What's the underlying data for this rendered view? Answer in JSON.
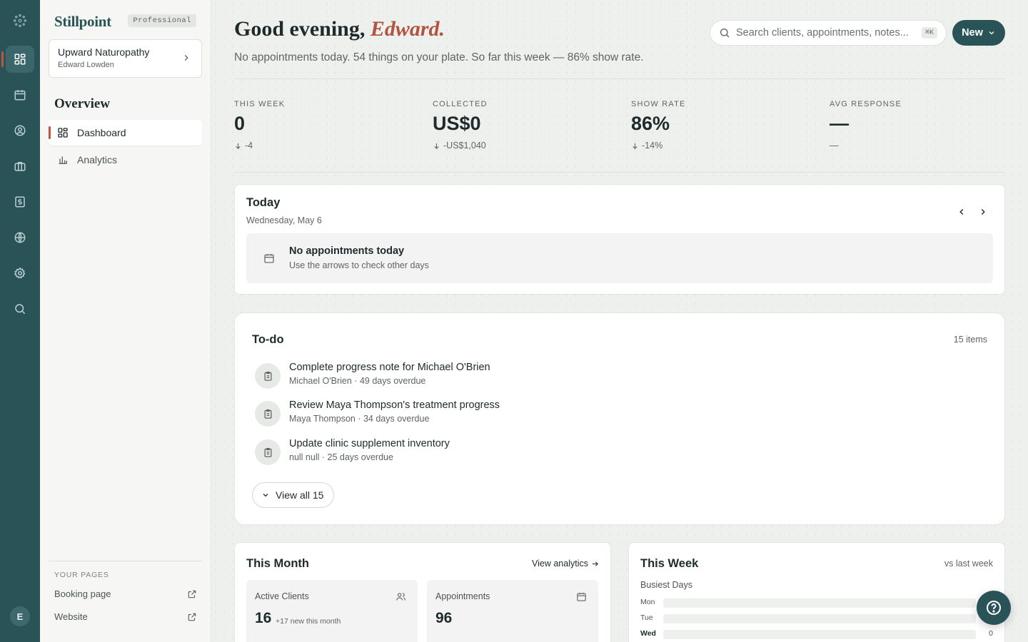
{
  "colors": {
    "rail": "#2a5358",
    "accent": "#b2533f",
    "primary": "#2a5358"
  },
  "rail": {
    "icons": [
      "dashboard-icon",
      "calendar-icon",
      "clients-icon",
      "briefcase-icon",
      "billing-icon",
      "globe-icon",
      "gear-icon",
      "search-icon"
    ],
    "avatar_initial": "E"
  },
  "sidebar": {
    "brand": "Stillpoint",
    "plan": "Professional",
    "clinic_name": "Upward Naturopathy",
    "clinic_user": "Edward Lowden",
    "section": "Overview",
    "nav": [
      {
        "label": "Dashboard",
        "icon": "dashboard-icon"
      },
      {
        "label": "Analytics",
        "icon": "bar-chart-icon"
      }
    ],
    "your_pages_title": "YOUR PAGES",
    "pages": [
      {
        "label": "Booking page",
        "icon": "external-link-icon"
      },
      {
        "label": "Website",
        "icon": "external-link-icon"
      }
    ]
  },
  "header": {
    "greeting_prefix": "Good evening,",
    "greeting_name": "Edward.",
    "subline": "No appointments today. 54 things on your plate. So far this week — 86% show rate.",
    "search_placeholder": "Search clients, appointments, notes...",
    "search_shortcut": "⌘K",
    "new_label": "New"
  },
  "stats": [
    {
      "label": "THIS WEEK",
      "value": "0",
      "delta": "-4",
      "arrow": true
    },
    {
      "label": "COLLECTED",
      "value": "US$0",
      "delta": "-US$1,040",
      "arrow": true
    },
    {
      "label": "SHOW RATE",
      "value": "86%",
      "delta": "-14%",
      "arrow": true
    },
    {
      "label": "AVG RESPONSE",
      "value": "—",
      "delta": "—",
      "arrow": false
    }
  ],
  "today": {
    "title": "Today",
    "date": "Wednesday, May 6",
    "empty_title": "No appointments today",
    "empty_sub": "Use the arrows to check other days"
  },
  "todo": {
    "title": "To-do",
    "count": "15 items",
    "items": [
      {
        "title": "Complete progress note for Michael O'Brien",
        "sub": "Michael O'Brien · 49 days overdue"
      },
      {
        "title": "Review Maya Thompson's treatment progress",
        "sub": "Maya Thompson · 34 days overdue"
      },
      {
        "title": "Update clinic supplement inventory",
        "sub": "null null · 25 days overdue"
      }
    ],
    "view_all": "View all 15"
  },
  "month": {
    "title": "This Month",
    "link": "View analytics",
    "cards": [
      {
        "label": "Active Clients",
        "value": "16",
        "sub": "+17 new this month",
        "icon": "users-icon"
      },
      {
        "label": "Appointments",
        "value": "96",
        "sub": "",
        "icon": "calendar-icon"
      }
    ]
  },
  "week": {
    "title": "This Week",
    "compare": "vs last week",
    "busiest_title": "Busiest Days",
    "days": [
      {
        "day": "Mon",
        "value": "",
        "highlight": false
      },
      {
        "day": "Tue",
        "value": "",
        "highlight": false
      },
      {
        "day": "Wed",
        "value": "0",
        "highlight": true
      }
    ]
  }
}
